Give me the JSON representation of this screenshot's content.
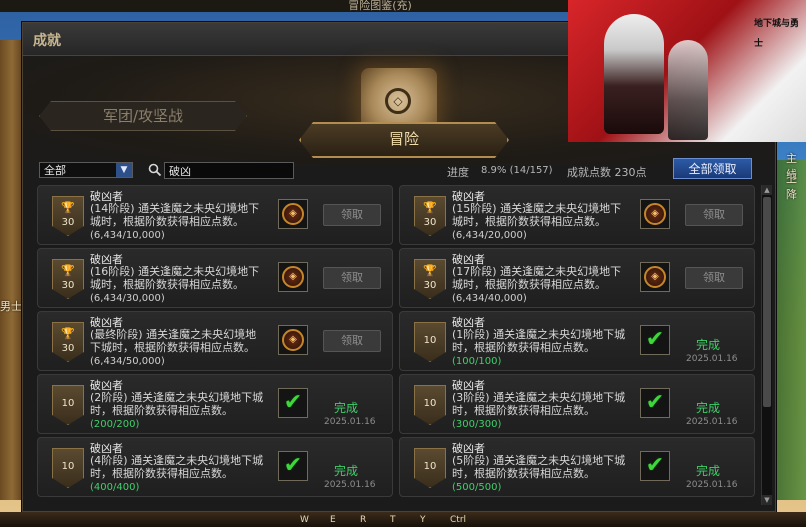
{
  "window": {
    "top_title": "冒险图鉴(充)",
    "title": "成就"
  },
  "tabs": {
    "left": "军团/攻坚战",
    "active": "冒险"
  },
  "filter": {
    "dropdown_value": "全部",
    "search_value": "破凶"
  },
  "summary": {
    "progress_label": "进度",
    "progress_value": "8.9% (14/157)",
    "points": "成就点数 230点",
    "claim_all_label": "全部领取"
  },
  "side_texts": {
    "left_fragment": "男士",
    "right_fragment_1": "主线",
    "right_fragment_2": "卫降"
  },
  "bottom_bar": [
    "W",
    "E",
    "R",
    "T",
    "Y",
    "Ctrl"
  ],
  "promo": {
    "logo_text": "地下城与勇士"
  },
  "achievements": [
    {
      "title": "破凶者",
      "desc": "(14阶段) 通关逢魔之未央幻境地下城时，根据阶数获得相应点数。",
      "progress": "(6,434/10,000)",
      "points": "30",
      "done": false,
      "claim_label": "领取",
      "status": "",
      "date": ""
    },
    {
      "title": "破凶者",
      "desc": "(15阶段) 通关逢魔之未央幻境地下城时，根据阶数获得相应点数。",
      "progress": "(6,434/20,000)",
      "points": "30",
      "done": false,
      "claim_label": "领取",
      "status": "",
      "date": ""
    },
    {
      "title": "破凶者",
      "desc": "(16阶段) 通关逢魔之未央幻境地下城时，根据阶数获得相应点数。",
      "progress": "(6,434/30,000)",
      "points": "30",
      "done": false,
      "claim_label": "领取",
      "status": "",
      "date": ""
    },
    {
      "title": "破凶者",
      "desc": "(17阶段) 通关逢魔之未央幻境地下城时，根据阶数获得相应点数。",
      "progress": "(6,434/40,000)",
      "points": "30",
      "done": false,
      "claim_label": "领取",
      "status": "",
      "date": ""
    },
    {
      "title": "破凶者",
      "desc": "(最终阶段) 通关逢魔之未央幻境地下城时，根据阶数获得相应点数。",
      "progress": "(6,434/50,000)",
      "points": "30",
      "done": false,
      "claim_label": "领取",
      "status": "",
      "date": ""
    },
    {
      "title": "破凶者",
      "desc": "(1阶段) 通关逢魔之未央幻境地下城时，根据阶数获得相应点数。",
      "progress": "(100/100)",
      "points": "10",
      "done": true,
      "claim_label": "",
      "status": "完成",
      "date": "2025.01.16"
    },
    {
      "title": "破凶者",
      "desc": "(2阶段) 通关逢魔之未央幻境地下城时，根据阶数获得相应点数。",
      "progress": "(200/200)",
      "points": "10",
      "done": true,
      "claim_label": "",
      "status": "完成",
      "date": "2025.01.16"
    },
    {
      "title": "破凶者",
      "desc": "(3阶段) 通关逢魔之未央幻境地下城时，根据阶数获得相应点数。",
      "progress": "(300/300)",
      "points": "10",
      "done": true,
      "claim_label": "",
      "status": "完成",
      "date": "2025.01.16"
    },
    {
      "title": "破凶者",
      "desc": "(4阶段) 通关逢魔之未央幻境地下城时，根据阶数获得相应点数。",
      "progress": "(400/400)",
      "points": "10",
      "done": true,
      "claim_label": "",
      "status": "完成",
      "date": "2025.01.16"
    },
    {
      "title": "破凶者",
      "desc": "(5阶段) 通关逢魔之未央幻境地下城时，根据阶数获得相应点数。",
      "progress": "(500/500)",
      "points": "10",
      "done": true,
      "claim_label": "",
      "status": "完成",
      "date": "2025.01.16"
    }
  ]
}
